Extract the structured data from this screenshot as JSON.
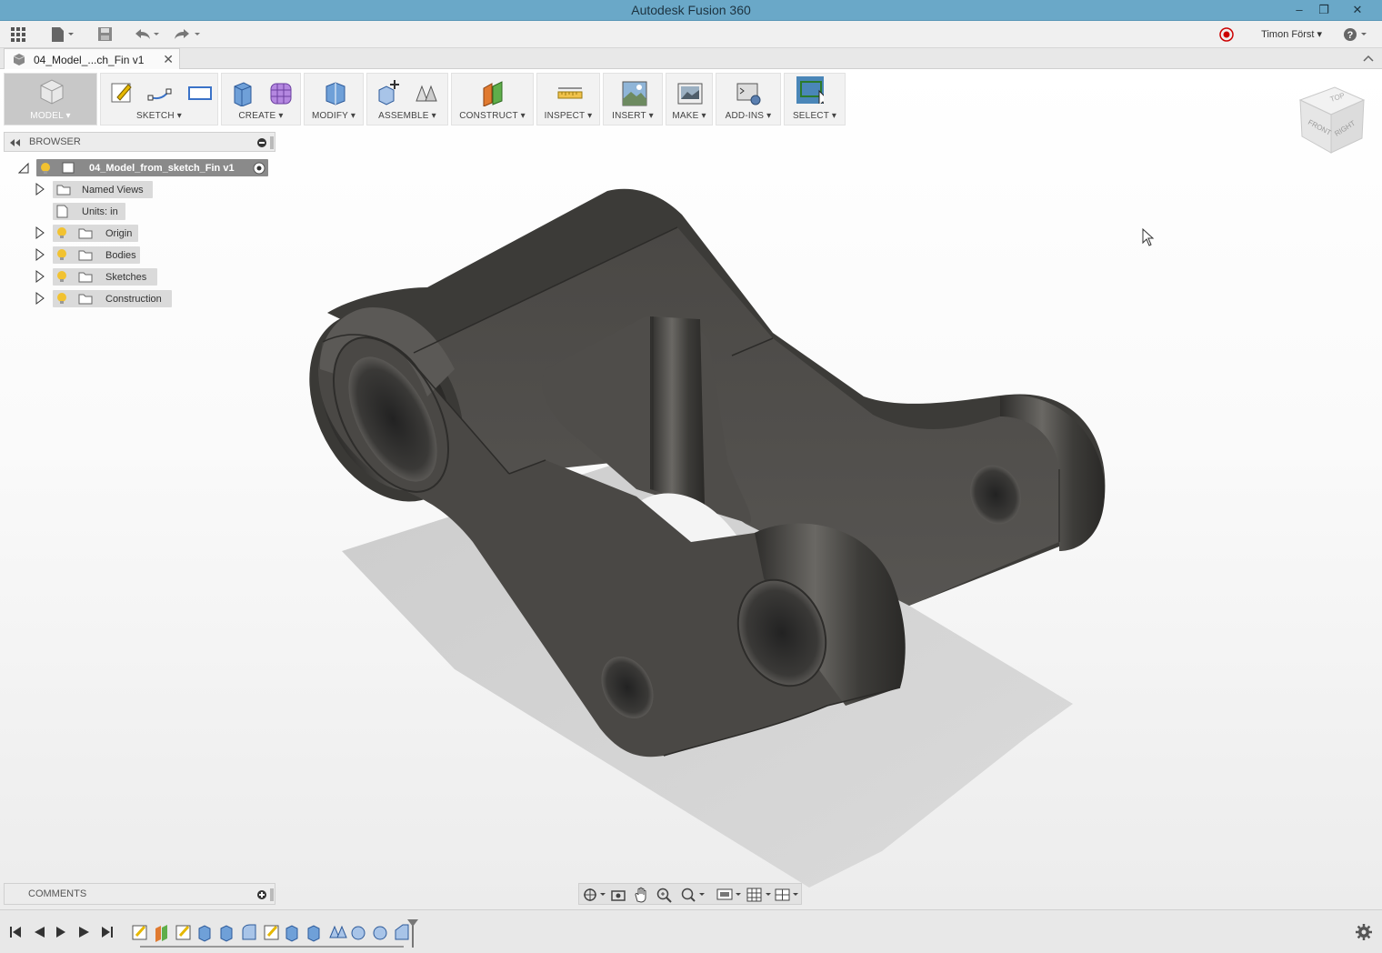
{
  "window": {
    "title": "Autodesk Fusion 360",
    "controls": [
      "–",
      "❐",
      "✕"
    ]
  },
  "appbar": {
    "user": "Timon Först ▾",
    "help": "?▾"
  },
  "document_tab": {
    "label": "04_Model_...ch_Fin v1",
    "close": "✕"
  },
  "toolbar": {
    "groups": [
      {
        "label": "MODEL ▾"
      },
      {
        "label": "SKETCH ▾"
      },
      {
        "label": "CREATE ▾"
      },
      {
        "label": "MODIFY ▾"
      },
      {
        "label": "ASSEMBLE ▾"
      },
      {
        "label": "CONSTRUCT ▾"
      },
      {
        "label": "INSPECT ▾"
      },
      {
        "label": "INSERT ▾"
      },
      {
        "label": "MAKE ▾"
      },
      {
        "label": "ADD-INS ▾"
      },
      {
        "label": "SELECT ▾"
      }
    ]
  },
  "browser": {
    "title": "BROWSER",
    "root": "04_Model_from_sketch_Fin v1",
    "items": [
      {
        "label": "Named Views"
      },
      {
        "label": "Units: in"
      },
      {
        "label": "Origin"
      },
      {
        "label": "Bodies"
      },
      {
        "label": "Sketches"
      },
      {
        "label": "Construction"
      }
    ]
  },
  "comments": {
    "title": "COMMENTS"
  },
  "viewcube": {
    "top": "TOP",
    "front": "FRONT",
    "right": "RIGHT"
  },
  "colors": {
    "titlebar": "#6aa8c8",
    "select_active": "#4a86b8",
    "model_body": "#4c4a47"
  }
}
